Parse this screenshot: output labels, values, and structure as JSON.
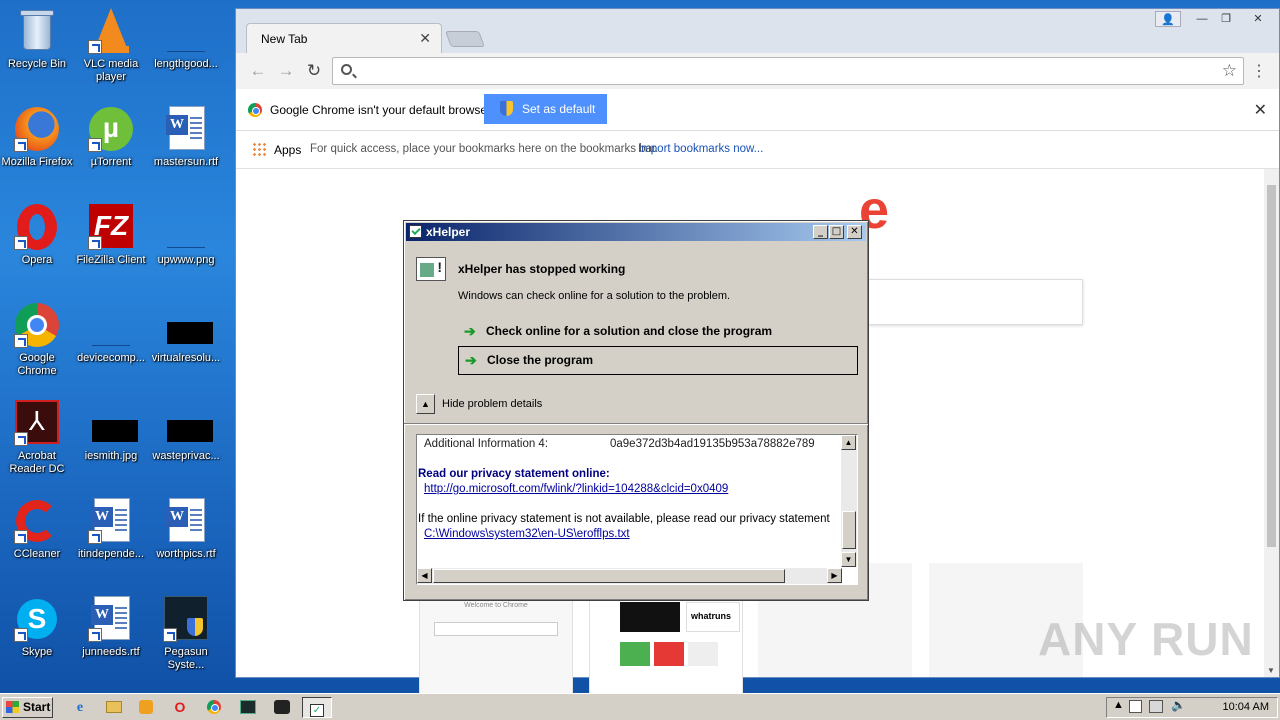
{
  "desktop": {
    "icons": [
      {
        "label": "Recycle Bin"
      },
      {
        "label": "VLC media player"
      },
      {
        "label": "lengthgood..."
      },
      {
        "label": "Mozilla Firefox"
      },
      {
        "label": "µTorrent"
      },
      {
        "label": "mastersun.rtf"
      },
      {
        "label": "Opera"
      },
      {
        "label": "FileZilla Client"
      },
      {
        "label": "upwww.png"
      },
      {
        "label": "Google Chrome"
      },
      {
        "label": "devicecomp..."
      },
      {
        "label": "virtualresolu..."
      },
      {
        "label": "Acrobat Reader DC"
      },
      {
        "label": "iesmith.jpg"
      },
      {
        "label": "wasteprivac..."
      },
      {
        "label": "CCleaner"
      },
      {
        "label": "itindepende..."
      },
      {
        "label": "worthpics.rtf"
      },
      {
        "label": "Skype"
      },
      {
        "label": "junneeds.rtf"
      },
      {
        "label": "Pegasun Syste..."
      }
    ]
  },
  "chrome": {
    "tab_title": "New Tab",
    "address_value": "",
    "infobar_text": "Google Chrome isn't your default browser.",
    "set_default_label": "Set as default",
    "bookmarks_apps": "Apps",
    "bookmarks_hint": "For quick access, place your bookmarks here on the bookmarks bar.",
    "bookmarks_import": "Import bookmarks now...",
    "thumbnail_1_caption": "Welcome to Chrome",
    "thumbnail_2_caption": "whatruns"
  },
  "dialog": {
    "title": "xHelper",
    "heading": "xHelper has stopped working",
    "subtext": "Windows can check online for a solution to the problem.",
    "option_check": "Check online for a solution and close the program",
    "option_close": "Close the program",
    "hide_details": "Hide problem details",
    "details": {
      "info_label": "Additional Information 4:",
      "info_value": "0a9e372d3b4ad19135b953a78882e789",
      "privacy_heading": "Read our privacy statement online:",
      "privacy_link": "http://go.microsoft.com/fwlink/?linkid=104288&clcid=0x0409",
      "offline_text": "If the online privacy statement is not available, please read our privacy statement",
      "offline_path": "C:\\Windows\\system32\\en-US\\erofflps.txt"
    }
  },
  "taskbar": {
    "start_label": "Start",
    "clock": "10:04 AM"
  },
  "watermark": "ANY RUN"
}
